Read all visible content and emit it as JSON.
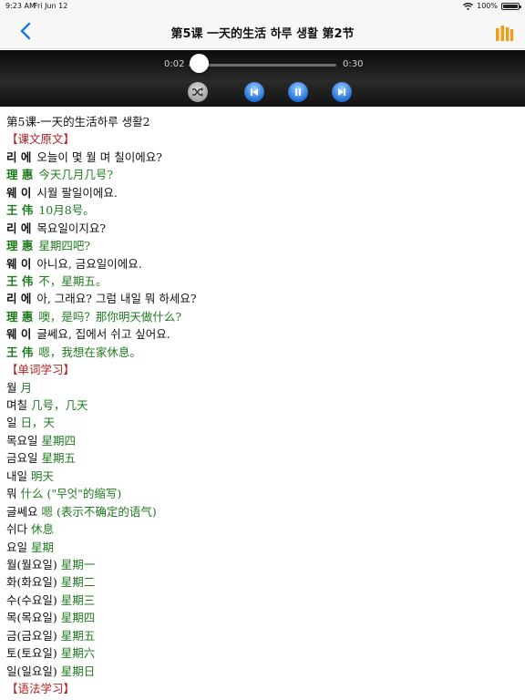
{
  "status_bar": {
    "time": "9:23 AM",
    "date": "Fri Jun 12",
    "battery": "100%",
    "battery_level": 1.0
  },
  "nav": {
    "title": "第5课 一天的生活 하루 생활 第2节",
    "back_icon": "chevron-left-icon",
    "list_icon": "bars-icon",
    "accent": "#1a7ae6",
    "list_color": "#f39c12"
  },
  "player": {
    "current_time": "0:02",
    "total_time": "0:30",
    "progress_fraction": 0.0667
  },
  "lesson": {
    "title": "第5课-一天的生活하루 생활2",
    "text_header": "【课文原文】",
    "dialogue": [
      {
        "speaker": "리  에",
        "text": "오늘이 몇 월 며 칠이에요?",
        "lang": "kr"
      },
      {
        "speaker": "理  惠",
        "text": "今天几月几号?",
        "lang": "cn"
      },
      {
        "speaker": "웨  이",
        "text": "시월 팔일이에요.",
        "lang": "kr"
      },
      {
        "speaker": "王  伟",
        "text": "10月8号。",
        "lang": "cn"
      },
      {
        "speaker": "리  에",
        "text": "목요일이지요?",
        "lang": "kr"
      },
      {
        "speaker": "理  惠",
        "text": "星期四吧?",
        "lang": "cn"
      },
      {
        "speaker": "웨  이",
        "text": "아니요, 금요일이에요.",
        "lang": "kr"
      },
      {
        "speaker": "王  伟",
        "text": "不，星期五。",
        "lang": "cn"
      },
      {
        "speaker": "리  에",
        "text": "아, 그래요? 그럼 내일 뭐 하세요?",
        "lang": "kr"
      },
      {
        "speaker": "理  惠",
        "text": "噢，是吗？那你明天做什么?",
        "lang": "cn"
      },
      {
        "speaker": "웨  이",
        "text": "글쎄요, 집에서 쉬고 싶어요.",
        "lang": "kr"
      },
      {
        "speaker": "王  伟",
        "text": "嗯，我想在家休息。",
        "lang": "cn"
      }
    ],
    "vocab_header": "【单词学习】",
    "vocab": [
      {
        "kr": "월",
        "cn": "月"
      },
      {
        "kr": "며칠",
        "cn": "几号，几天"
      },
      {
        "kr": "일",
        "cn": "日，天"
      },
      {
        "kr": "목요일",
        "cn": "星期四"
      },
      {
        "kr": "금요일",
        "cn": "星期五"
      },
      {
        "kr": "내일",
        "cn": "明天"
      },
      {
        "kr": "뭐",
        "cn": "什么 (\"무엇\"的缩写)"
      },
      {
        "kr": "글쎄요",
        "cn": "嗯 (表示不确定的语气)"
      },
      {
        "kr": "쉬다",
        "cn": "休息"
      },
      {
        "kr": "요일",
        "cn": "星期"
      },
      {
        "kr": "월(월요일)",
        "cn": "星期一"
      },
      {
        "kr": "화(화요일)",
        "cn": "星期二"
      },
      {
        "kr": "수(수요일)",
        "cn": "星期三"
      },
      {
        "kr": "목(목요일)",
        "cn": "星期四"
      },
      {
        "kr": "금(금요일)",
        "cn": "星期五"
      },
      {
        "kr": "토(토요일)",
        "cn": "星期六"
      },
      {
        "kr": "일(일요일)",
        "cn": "星期日"
      }
    ],
    "grammar_header": "【语法学习】"
  }
}
